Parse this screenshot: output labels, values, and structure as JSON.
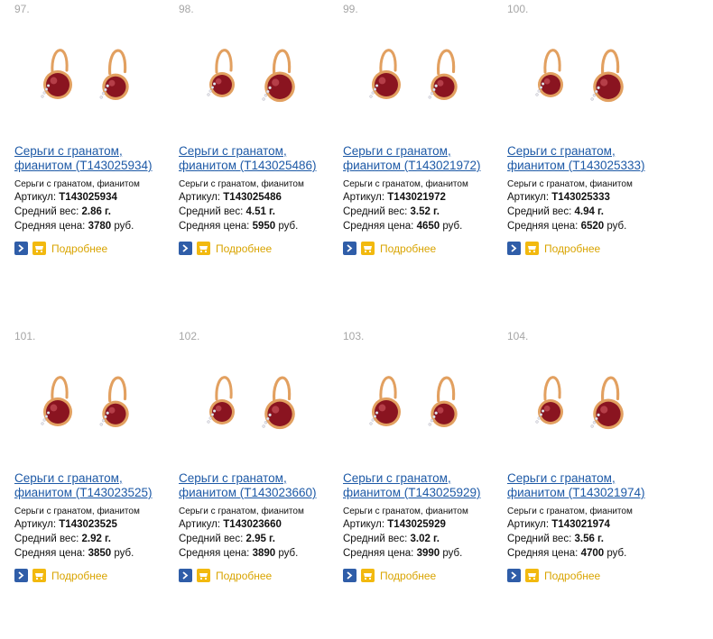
{
  "products": [
    {
      "num": "97.",
      "title": "Серьги с гранатом, фианитом (Т143025934)",
      "sub": "Серьги с гранатом, фианитом",
      "article_label": "Артикул:",
      "article": "Т143025934",
      "weight_label": "Средний вес:",
      "weight": "2.86 г.",
      "price_label": "Средняя цена:",
      "price": "3780",
      "price_unit": "руб.",
      "more": "Подробнее"
    },
    {
      "num": "98.",
      "title": "Серьги с гранатом, фианитом (Т143025486)",
      "sub": "Серьги с гранатом, фианитом",
      "article_label": "Артикул:",
      "article": "Т143025486",
      "weight_label": "Средний вес:",
      "weight": "4.51 г.",
      "price_label": "Средняя цена:",
      "price": "5950",
      "price_unit": "руб.",
      "more": "Подробнее"
    },
    {
      "num": "99.",
      "title": "Серьги с гранатом, фианитом (Т143021972)",
      "sub": "Серьги с гранатом, фианитом",
      "article_label": "Артикул:",
      "article": "Т143021972",
      "weight_label": "Средний вес:",
      "weight": "3.52 г.",
      "price_label": "Средняя цена:",
      "price": "4650",
      "price_unit": "руб.",
      "more": "Подробнее"
    },
    {
      "num": "100.",
      "title": "Серьги с гранатом, фианитом (Т143025333)",
      "sub": "Серьги с гранатом, фианитом",
      "article_label": "Артикул:",
      "article": "Т143025333",
      "weight_label": "Средний вес:",
      "weight": "4.94 г.",
      "price_label": "Средняя цена:",
      "price": "6520",
      "price_unit": "руб.",
      "more": "Подробнее"
    },
    {
      "num": "101.",
      "title": "Серьги с гранатом, фианитом (Т143023525)",
      "sub": "Серьги с гранатом, фианитом",
      "article_label": "Артикул:",
      "article": "Т143023525",
      "weight_label": "Средний вес:",
      "weight": "2.92 г.",
      "price_label": "Средняя цена:",
      "price": "3850",
      "price_unit": "руб.",
      "more": "Подробнее"
    },
    {
      "num": "102.",
      "title": "Серьги с гранатом, фианитом (Т143023660)",
      "sub": "Серьги с гранатом, фианитом",
      "article_label": "Артикул:",
      "article": "Т143023660",
      "weight_label": "Средний вес:",
      "weight": "2.95 г.",
      "price_label": "Средняя цена:",
      "price": "3890",
      "price_unit": "руб.",
      "more": "Подробнее"
    },
    {
      "num": "103.",
      "title": "Серьги с гранатом, фианитом (Т143025929)",
      "sub": "Серьги с гранатом, фианитом",
      "article_label": "Артикул:",
      "article": "Т143025929",
      "weight_label": "Средний вес:",
      "weight": "3.02 г.",
      "price_label": "Средняя цена:",
      "price": "3990",
      "price_unit": "руб.",
      "more": "Подробнее"
    },
    {
      "num": "104.",
      "title": "Серьги с гранатом, фианитом (Т143021974)",
      "sub": "Серьги с гранатом, фианитом",
      "article_label": "Артикул:",
      "article": "Т143021974",
      "weight_label": "Средний вес:",
      "weight": "3.56 г.",
      "price_label": "Средняя цена:",
      "price": "4700",
      "price_unit": "руб.",
      "more": "Подробнее"
    }
  ],
  "colors": {
    "link": "#1d59a6",
    "more": "#d9a400",
    "num": "#a6a6a6",
    "gold": "#e2a060",
    "garnet": "#8a1420",
    "arrow_button": "#2f5da8",
    "cart_button": "#f2b90f"
  },
  "icons": {
    "details": "arrow-right-icon",
    "cart": "cart-icon",
    "product": "earring-photo"
  }
}
